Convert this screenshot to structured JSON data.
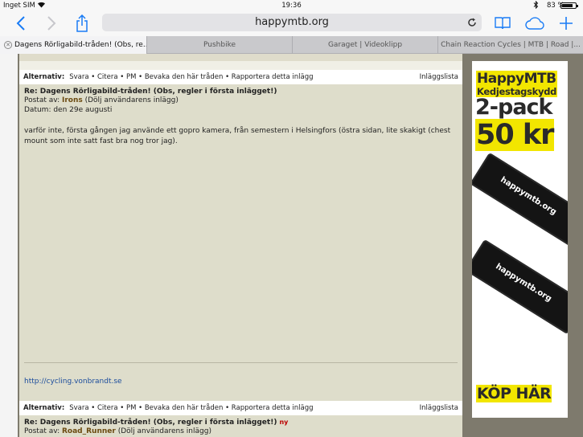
{
  "status": {
    "carrier": "Inget SIM",
    "time": "19:36",
    "battery": "83 %",
    "battery_level": 0.83,
    "icons": [
      "wifi-icon",
      "bluetooth-icon",
      "battery-icon"
    ]
  },
  "toolbar": {
    "url": "happymtb.org",
    "icons": [
      "back-icon",
      "forward-icon",
      "share-icon",
      "reload-icon",
      "bookmarks-icon",
      "icloud-tabs-icon",
      "new-tab-icon"
    ]
  },
  "tabs": [
    {
      "label": "Dagens Rörligabild-tråden! (Obs, re...",
      "active": true
    },
    {
      "label": "Pushbike",
      "active": false
    },
    {
      "label": "Garaget | Videoklipp",
      "active": false
    },
    {
      "label": "Chain Reaction Cycles | MTB | Road |...",
      "active": false
    }
  ],
  "options": {
    "label": "Alternativ:",
    "actions": "Svara • Citera • PM • Bevaka den här tråden • Rapportera detta inlägg",
    "list": "Inläggslista"
  },
  "posts": [
    {
      "title": "Re: Dagens Rörligabild-tråden! (Obs, regler i första inlägget!)",
      "posted_by_label": "Postat av:",
      "author": "Irons",
      "hide": "(Dölj användarens inlägg)",
      "date": "Datum: den 29e augusti",
      "body": "varför inte, första gången jag använde ett gopro kamera, från semestern i Helsingfors (östra sidan, lite skakigt (chest mount som inte satt fast bra nog tror jag).",
      "link": "http://cycling.vonbrandt.se"
    },
    {
      "title": "Re: Dagens Rörligabild-tråden! (Obs, regler i första inlägget!)",
      "new_badge": "ny",
      "posted_by_label": "Postat av:",
      "author": "Road_Runner",
      "hide": "(Dölj användarens inlägg)"
    }
  ],
  "ad": {
    "brand": "HappyMTB",
    "product": "Kedjestagskydd",
    "pack": "2-pack",
    "price": "50 kr",
    "guard_text": "happymtb.org",
    "cta": "KÖP HÄR",
    "accent": "#f2e600"
  }
}
